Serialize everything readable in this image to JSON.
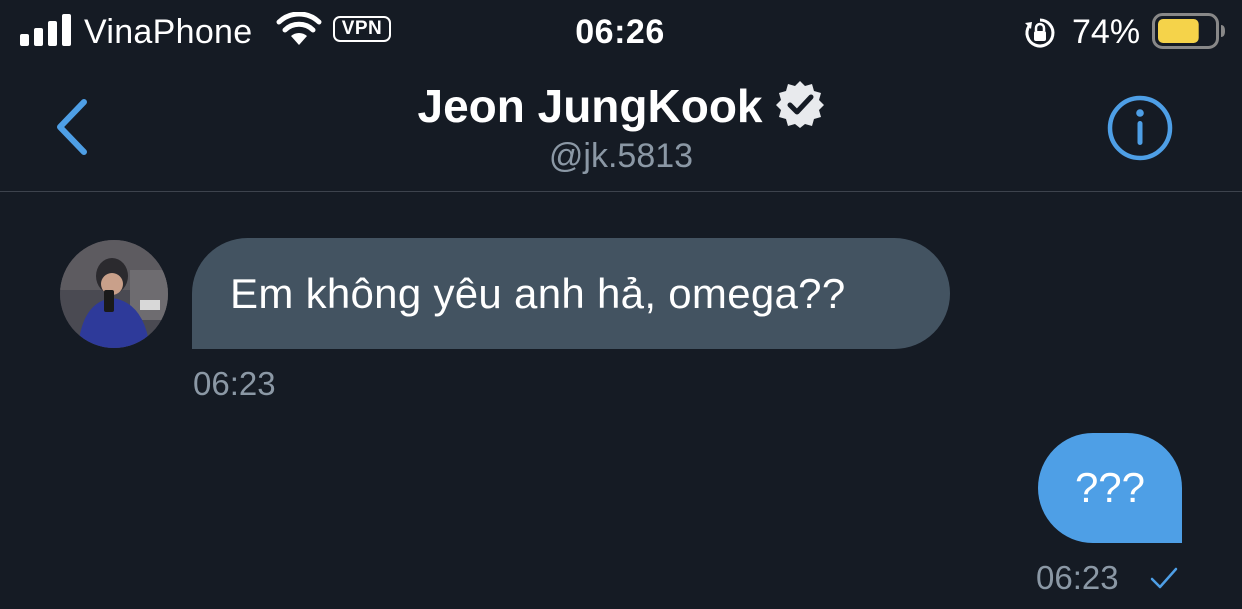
{
  "status_bar": {
    "carrier": "VinaPhone",
    "vpn_label": "VPN",
    "time": "06:26",
    "battery_percent": "74%",
    "battery_level": 0.74,
    "battery_color": "#f5d34a",
    "icons": [
      "signal-icon",
      "wifi-icon",
      "rotation-lock-icon",
      "battery-icon"
    ]
  },
  "header": {
    "name": "Jeon JungKook",
    "handle": "@jk.5813",
    "verified": true,
    "back_icon": "chevron-left-icon",
    "info_icon": "info-icon",
    "accent_color": "#4e9fe6"
  },
  "messages": [
    {
      "direction": "incoming",
      "text": "Em không yêu anh hả, omega??",
      "timestamp": "06:23"
    },
    {
      "direction": "outgoing",
      "text": "???",
      "timestamp": "06:23",
      "status": "sent-check"
    }
  ],
  "colors": {
    "background": "#151b24",
    "incoming_bubble": "#435361",
    "outgoing_bubble": "#4e9fe6",
    "secondary_text": "#8b98a5"
  }
}
